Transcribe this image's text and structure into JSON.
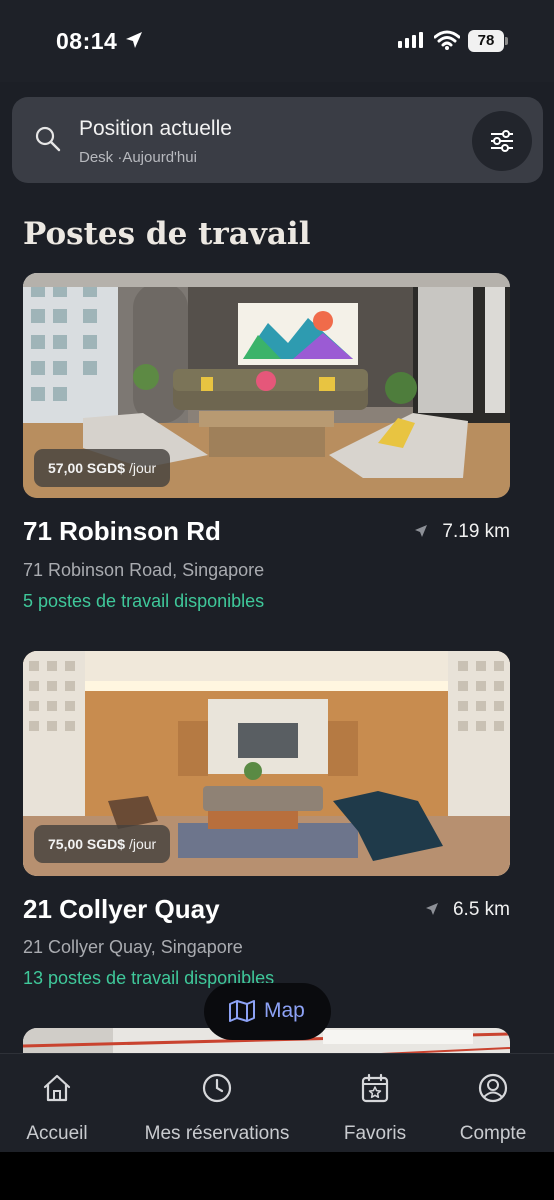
{
  "status_bar": {
    "time": "08:14",
    "battery": "78"
  },
  "search": {
    "title": "Position actuelle",
    "subtitle": "Desk ·Aujourd'hui"
  },
  "section_title": "Postes de travail",
  "listings": [
    {
      "price_amount": "57,00 SGD$",
      "price_unit": "/jour",
      "name": "71 Robinson Rd",
      "distance": "7.19 km",
      "address": "71 Robinson Road, Singapore",
      "availability": "5 postes de travail disponibles"
    },
    {
      "price_amount": "75,00 SGD$",
      "price_unit": "/jour",
      "name": "21 Collyer Quay",
      "distance": "6.5 km",
      "address": "21 Collyer Quay, Singapore",
      "availability": "13 postes de travail disponibles"
    }
  ],
  "map_button": {
    "label": "Map"
  },
  "tabs": [
    {
      "label": "Accueil",
      "icon": "home-icon"
    },
    {
      "label": "Mes réservations",
      "icon": "clock-icon"
    },
    {
      "label": "Favoris",
      "icon": "calendar-star-icon"
    },
    {
      "label": "Compte",
      "icon": "account-icon"
    }
  ],
  "colors": {
    "background": "#1c1f26",
    "card": "#3a3d45",
    "accent_green": "#3fc89a",
    "map_link": "#8da2f5"
  }
}
